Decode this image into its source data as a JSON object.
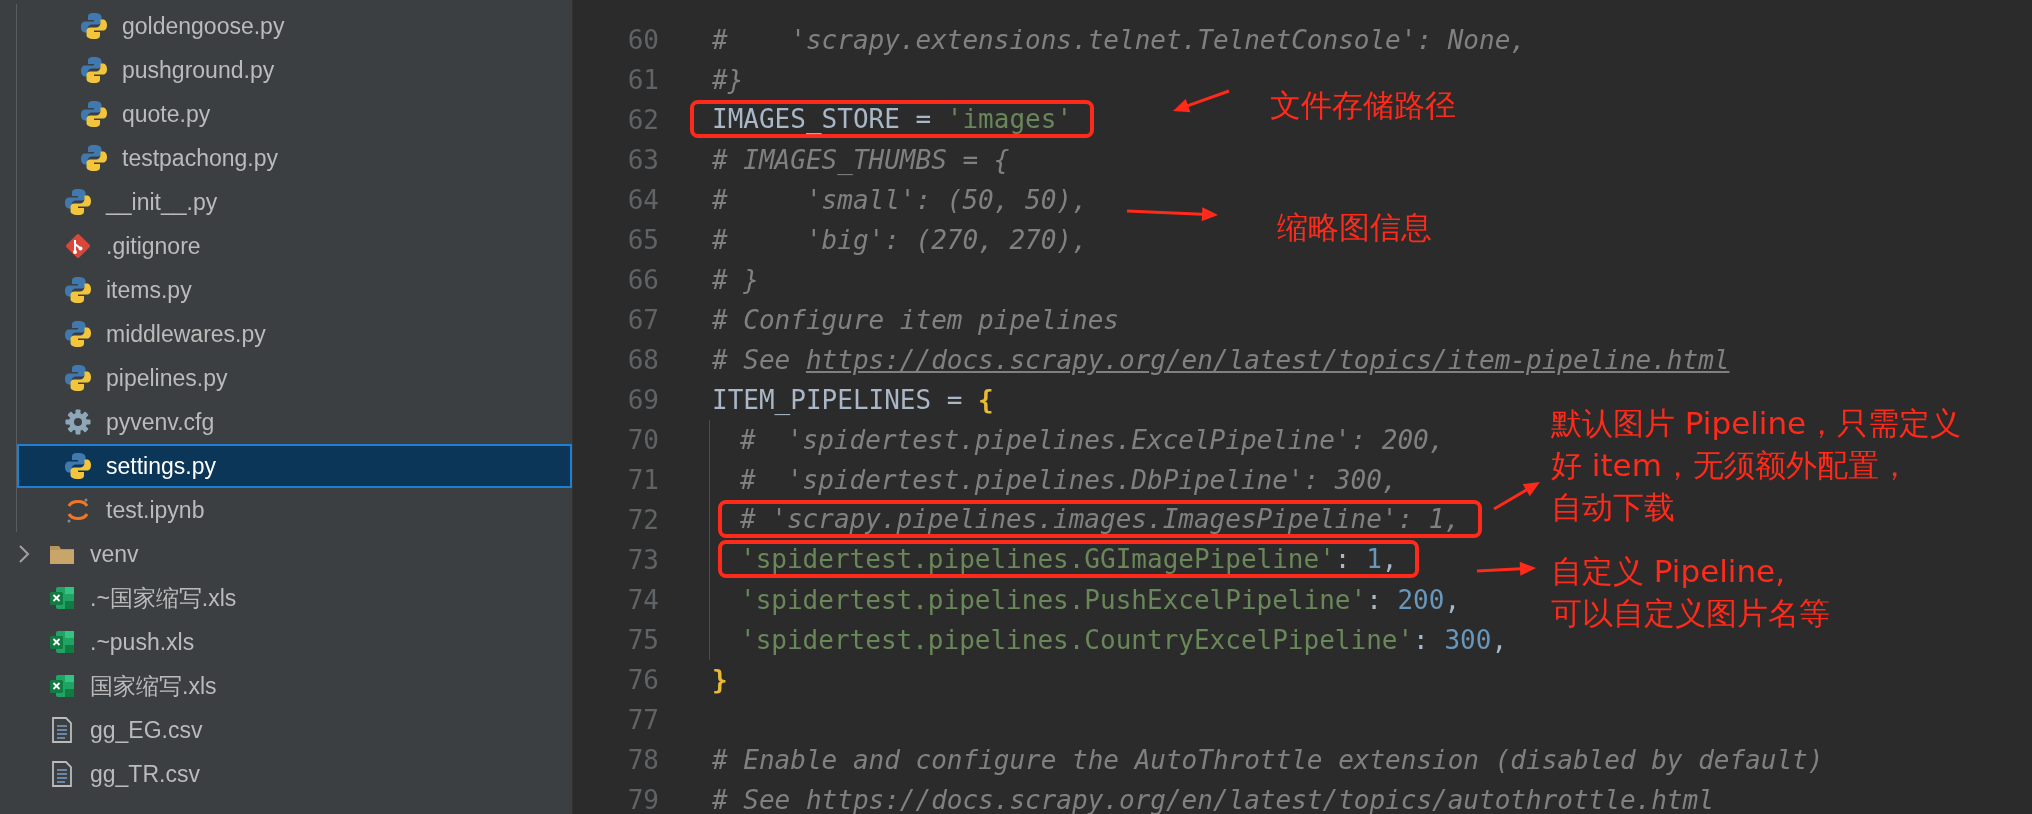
{
  "sidebar": {
    "tree": [
      {
        "children": [
          {
            "children": [
              {
                "label": "goldengoose.py",
                "kind": "python",
                "selected": false
              },
              {
                "label": "pushground.py",
                "kind": "python",
                "selected": false
              },
              {
                "label": "quote.py",
                "kind": "python",
                "selected": false
              },
              {
                "label": "testpachong.py",
                "kind": "python",
                "selected": false
              }
            ]
          },
          {
            "label": "__init__.py",
            "kind": "python",
            "selected": false
          },
          {
            "label": ".gitignore",
            "kind": "git",
            "selected": false
          },
          {
            "label": "items.py",
            "kind": "python",
            "selected": false
          },
          {
            "label": "middlewares.py",
            "kind": "python",
            "selected": false
          },
          {
            "label": "pipelines.py",
            "kind": "python",
            "selected": false
          },
          {
            "label": "pyvenv.cfg",
            "kind": "config",
            "selected": false
          },
          {
            "label": "settings.py",
            "kind": "python",
            "selected": true
          },
          {
            "label": "test.ipynb",
            "kind": "jupyter",
            "selected": false
          }
        ]
      },
      {
        "label": "venv",
        "kind": "folder",
        "expanded": false,
        "selected": false
      },
      {
        "label": ".~国家缩写.xls",
        "kind": "excel",
        "selected": false
      },
      {
        "label": ".~push.xls",
        "kind": "excel",
        "selected": false
      },
      {
        "label": "国家缩写.xls",
        "kind": "excel",
        "selected": false
      },
      {
        "label": "gg_EG.csv",
        "kind": "text",
        "selected": false
      },
      {
        "label": "gg_TR.csv",
        "kind": "text",
        "selected": false
      }
    ]
  },
  "code": {
    "lines": [
      {
        "number": "60",
        "guide": false,
        "boxed": false,
        "tokens": [
          {
            "kind": "comment",
            "text": "#    'scrapy.extensions.telnet.TelnetConsole': None,"
          }
        ]
      },
      {
        "number": "61",
        "guide": false,
        "boxed": false,
        "tokens": [
          {
            "kind": "comment",
            "text": "#}"
          }
        ]
      },
      {
        "number": "62",
        "guide": false,
        "boxed": true,
        "tokens": [
          {
            "kind": "plain",
            "text": "IMAGES_STORE = "
          },
          {
            "kind": "string",
            "text": "'images'"
          }
        ]
      },
      {
        "number": "63",
        "guide": false,
        "boxed": false,
        "tokens": [
          {
            "kind": "comment",
            "text": "# IMAGES_THUMBS = {"
          }
        ]
      },
      {
        "number": "64",
        "guide": false,
        "boxed": false,
        "tokens": [
          {
            "kind": "comment",
            "text": "#     'small': (50, 50),"
          }
        ]
      },
      {
        "number": "65",
        "guide": false,
        "boxed": false,
        "tokens": [
          {
            "kind": "comment",
            "text": "#     'big': (270, 270),"
          }
        ]
      },
      {
        "number": "66",
        "guide": false,
        "boxed": false,
        "tokens": [
          {
            "kind": "comment",
            "text": "# }"
          }
        ]
      },
      {
        "number": "67",
        "guide": false,
        "boxed": false,
        "tokens": [
          {
            "kind": "comment",
            "text": "# Configure item pipelines"
          }
        ]
      },
      {
        "number": "68",
        "guide": false,
        "boxed": false,
        "tokens": [
          {
            "kind": "comment",
            "text": "# See "
          },
          {
            "kind": "link",
            "text": "https://docs.scrapy.org/en/latest/topics/item-pipeline.html"
          }
        ]
      },
      {
        "number": "69",
        "guide": false,
        "boxed": false,
        "tokens": [
          {
            "kind": "plain",
            "text": "ITEM_PIPELINES = "
          },
          {
            "kind": "brace",
            "text": "{"
          }
        ]
      },
      {
        "number": "70",
        "guide": true,
        "boxed": false,
        "tokens": [
          {
            "kind": "comment",
            "text": "#  'spidertest.pipelines.ExcelPipeline': 200,"
          }
        ]
      },
      {
        "number": "71",
        "guide": true,
        "boxed": false,
        "tokens": [
          {
            "kind": "comment",
            "text": "#  'spidertest.pipelines.DbPipeline': 300,"
          }
        ]
      },
      {
        "number": "72",
        "guide": true,
        "boxed": true,
        "tokens": [
          {
            "kind": "comment",
            "text": "# 'scrapy.pipelines.images.ImagesPipeline': 1,"
          }
        ]
      },
      {
        "number": "73",
        "guide": true,
        "boxed": true,
        "tokens": [
          {
            "kind": "string",
            "text": "'spidertest.pipelines.GGImagePipeline'"
          },
          {
            "kind": "plain",
            "text": ": "
          },
          {
            "kind": "number",
            "text": "1"
          },
          {
            "kind": "plain",
            "text": ","
          }
        ]
      },
      {
        "number": "74",
        "guide": true,
        "boxed": false,
        "tokens": [
          {
            "kind": "string",
            "text": "'spidertest.pipelines.PushExcelPipeline'"
          },
          {
            "kind": "plain",
            "text": ": "
          },
          {
            "kind": "number",
            "text": "200"
          },
          {
            "kind": "plain",
            "text": ","
          }
        ]
      },
      {
        "number": "75",
        "guide": true,
        "boxed": false,
        "tokens": [
          {
            "kind": "string",
            "text": "'spidertest.pipelines.CountryExcelPipeline'"
          },
          {
            "kind": "plain",
            "text": ": "
          },
          {
            "kind": "number",
            "text": "300"
          },
          {
            "kind": "plain",
            "text": ","
          }
        ]
      },
      {
        "number": "76",
        "guide": false,
        "boxed": false,
        "tokens": [
          {
            "kind": "brace",
            "text": "}"
          }
        ]
      },
      {
        "number": "77",
        "guide": false,
        "boxed": false
      },
      {
        "number": "78",
        "guide": false,
        "boxed": false,
        "tokens": [
          {
            "kind": "comment",
            "text": "# Enable and configure the AutoThrottle extension (disabled by default)"
          }
        ]
      },
      {
        "number": "79",
        "guide": false,
        "boxed": false,
        "tokens": [
          {
            "kind": "comment",
            "text": "# See https://docs.scrapy.org/en/latest/topics/autothrottle.html"
          }
        ]
      }
    ]
  },
  "notes": [
    {
      "text": "文件存储路径"
    },
    {
      "text": "缩略图信息"
    },
    {
      "text": "默认图片 Pipeline，只需定义"
    },
    {
      "text": "好 item，无须额外配置，"
    },
    {
      "text": "自动下载"
    },
    {
      "text": "自定义 Pipeline,"
    },
    {
      "text": "可以自定义图片名等"
    }
  ]
}
